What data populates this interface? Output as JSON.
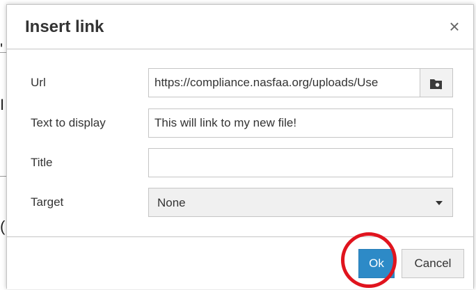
{
  "dialog": {
    "title": "Insert link",
    "close_glyph": "×",
    "fields": {
      "url": {
        "label": "Url",
        "value": "https://compliance.nasfaa.org/uploads/Use",
        "browse_icon": "folder-search-icon"
      },
      "text_to_display": {
        "label": "Text to display",
        "value": "This will link to my new file!"
      },
      "title": {
        "label": "Title",
        "value": ""
      },
      "target": {
        "label": "Target",
        "selected": "None"
      }
    },
    "buttons": {
      "ok": "Ok",
      "cancel": "Cancel"
    }
  },
  "annotation": {
    "ring_color": "#e0141e"
  },
  "colors": {
    "primary_button": "#2d8ac7",
    "border": "#c5c5c5"
  }
}
